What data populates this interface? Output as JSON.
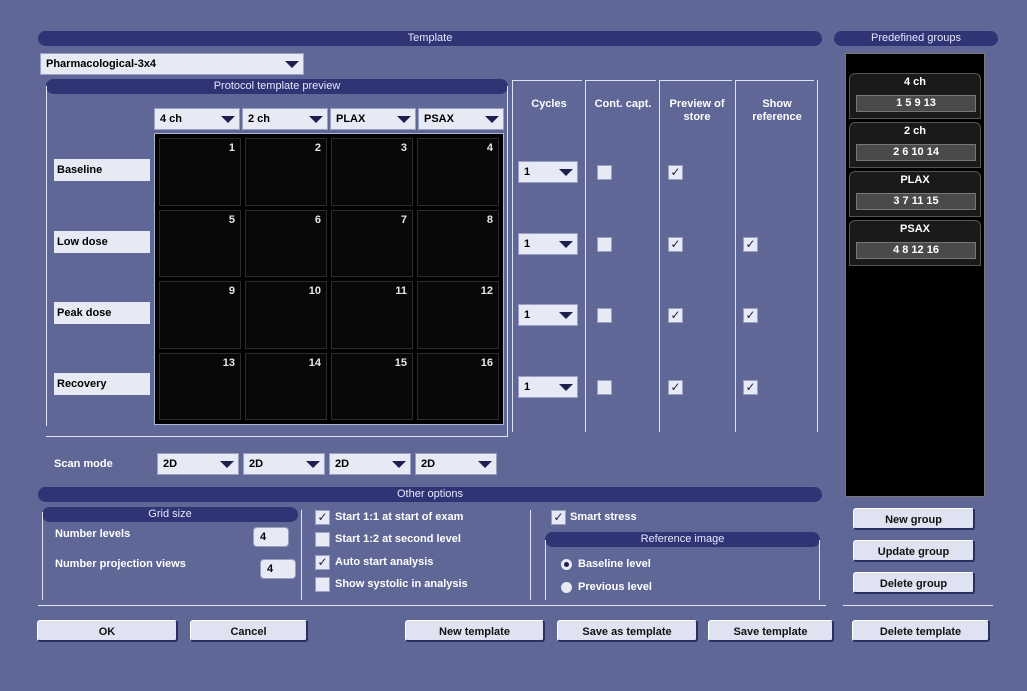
{
  "template": {
    "header": "Template",
    "selected_template": "Pharmacological-3x4",
    "preview_header": "Protocol template preview",
    "view_combos": [
      "4 ch",
      "2 ch",
      "PLAX",
      "PSAX"
    ],
    "rows": [
      "Baseline",
      "Low dose",
      "Peak dose",
      "Recovery"
    ],
    "cells": [
      "1",
      "2",
      "3",
      "4",
      "5",
      "6",
      "7",
      "8",
      "9",
      "10",
      "11",
      "12",
      "13",
      "14",
      "15",
      "16"
    ],
    "scan_mode_label": "Scan mode",
    "scan_modes": [
      "2D",
      "2D",
      "2D",
      "2D"
    ]
  },
  "columns": {
    "cycles": "Cycles",
    "cont_capt": "Cont. capt.",
    "preview_of_store": "Preview of store",
    "show_reference": "Show reference"
  },
  "cycles_values": [
    "1",
    "1",
    "1",
    "1"
  ],
  "row_checks": [
    {
      "cont": false,
      "preview": true,
      "reference": false
    },
    {
      "cont": false,
      "preview": true,
      "reference": true
    },
    {
      "cont": false,
      "preview": true,
      "reference": true
    },
    {
      "cont": false,
      "preview": true,
      "reference": true
    }
  ],
  "check_glyph": "✓",
  "predefined_groups": {
    "header": "Predefined groups",
    "groups": [
      {
        "name": "4 ch",
        "views": "1 5 9 13"
      },
      {
        "name": "2 ch",
        "views": "2 6 10 14"
      },
      {
        "name": "PLAX",
        "views": "3 7 11 15"
      },
      {
        "name": "PSAX",
        "views": "4 8 12 16"
      }
    ],
    "buttons": {
      "new": "New group",
      "update": "Update group",
      "delete": "Delete group"
    }
  },
  "other_options": {
    "header": "Other options",
    "grid_size": {
      "header": "Grid size",
      "number_levels_label": "Number levels",
      "number_levels": "4",
      "number_projection_label": "Number projection views",
      "number_projection": "4"
    },
    "options": [
      {
        "label": "Start 1:1 at start of exam",
        "checked": true
      },
      {
        "label": "Start 1:2 at second level",
        "checked": false
      },
      {
        "label": "Auto start analysis",
        "checked": true
      },
      {
        "label": "Show systolic in analysis",
        "checked": false
      }
    ],
    "smart_stress": {
      "label": "Smart stress",
      "checked": true
    },
    "reference_image": {
      "header": "Reference image",
      "options": [
        {
          "label": "Baseline level",
          "selected": true
        },
        {
          "label": "Previous level",
          "selected": false
        }
      ]
    }
  },
  "bottom_buttons": {
    "ok": "OK",
    "cancel": "Cancel",
    "new_template": "New template",
    "save_as_template": "Save as template",
    "save_template": "Save template",
    "delete_template": "Delete template"
  }
}
